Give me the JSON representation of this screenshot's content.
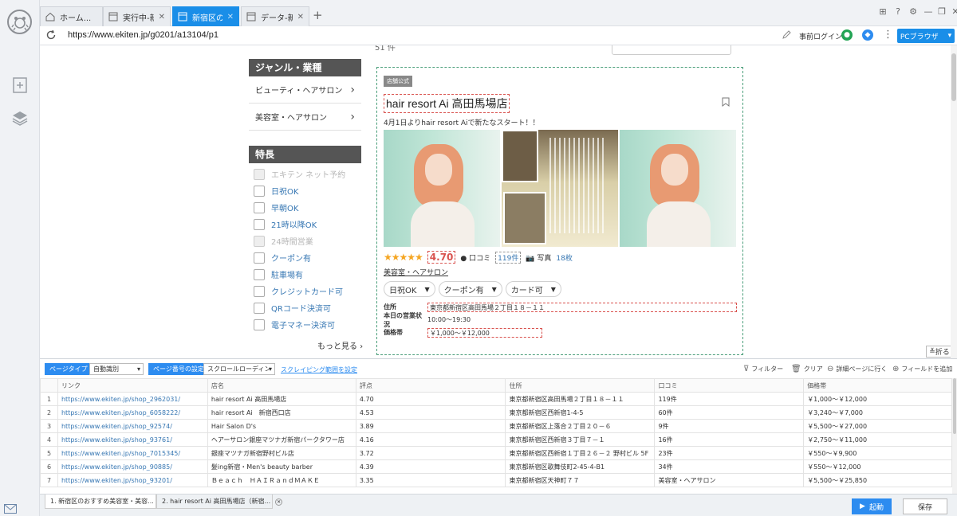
{
  "tabs": [
    {
      "label": "ホーム...",
      "active": false
    },
    {
      "label": "実行中-新...",
      "active": false
    },
    {
      "label": "新宿区の...",
      "active": true
    },
    {
      "label": "データ-新...",
      "active": false
    }
  ],
  "address": {
    "url": "https://www.ekiten.jp/g0201/a13104/p1",
    "prelogin": "事前ログイン",
    "pc_browser": "PCブラウザ"
  },
  "page": {
    "top_fragment": "51 件",
    "genre_header": "ジャンル・業種",
    "genre_items": [
      "ビューティ・ヘアサロン",
      "美容室・ヘアサロン"
    ],
    "feature_header": "特長",
    "features": [
      {
        "label": "エキテン ネット予約",
        "disabled": true
      },
      {
        "label": "日祝OK",
        "disabled": false
      },
      {
        "label": "早朝OK",
        "disabled": false
      },
      {
        "label": "21時以降OK",
        "disabled": false
      },
      {
        "label": "24時間営業",
        "disabled": true
      },
      {
        "label": "クーポン有",
        "disabled": false
      },
      {
        "label": "駐車場有",
        "disabled": false
      },
      {
        "label": "クレジットカード可",
        "disabled": false
      },
      {
        "label": "QRコード決済可",
        "disabled": false
      },
      {
        "label": "電子マネー決済可",
        "disabled": false
      }
    ],
    "more_link": "もっと見る",
    "card": {
      "badge": "店舗公式",
      "title": "hair resort Ai 高田馬場店",
      "desc": "4月1日よりhair resort Aiで新たなスタート！！",
      "score": "4.70",
      "reviews_label": "口コミ",
      "reviews_count": "119件",
      "photos_label": "写真",
      "photos_count": "18枚",
      "genre": "美容室・ヘアサロン",
      "pills": [
        "日祝OK",
        "クーポン有",
        "カード可"
      ],
      "address_label": "住所",
      "address": "東京都新宿区高田馬場２丁目１８－１１",
      "hours_label": "本日の営業状況",
      "hours": "10:00～19:30",
      "price_label": "価格帯",
      "price": "￥1,000～￥12,000"
    },
    "fold_label": "折る"
  },
  "panel": {
    "page_type_label": "ページタイプ",
    "page_type_value": "自動識別",
    "page_num_label": "ページ番号の設定",
    "page_num_value": "スクロールローディン",
    "scrape_range": "スクレイピング範囲を設定",
    "actions": {
      "filter": "フィルター",
      "clear": "クリア",
      "detail": "詳細ページに行く",
      "add_field": "フィールドを追加"
    },
    "columns": [
      "リンク",
      "店名",
      "評点",
      "住所",
      "口コミ",
      "価格帯"
    ],
    "rows": [
      [
        "1",
        "https://www.ekiten.jp/shop_2962031/",
        "hair resort Ai 高田馬場店",
        "4.70",
        "東京都新宿区高田馬場２丁目１８－１１",
        "119件",
        "￥1,000～￥12,000"
      ],
      [
        "2",
        "https://www.ekiten.jp/shop_6058222/",
        "hair resort Ai　新宿西口店",
        "4.53",
        "東京都新宿区西新宿1-4-5",
        "60件",
        "￥3,240～￥7,000"
      ],
      [
        "3",
        "https://www.ekiten.jp/shop_92574/",
        "Hair Salon D's",
        "3.89",
        "東京都新宿区上落合２丁目２０－６",
        "9件",
        "￥5,500～￥27,000"
      ],
      [
        "4",
        "https://www.ekiten.jp/shop_93761/",
        "ヘアーサロン銀座マツナガ新宿パークタワー店",
        "4.16",
        "東京都新宿区西新宿３丁目７－１",
        "16件",
        "￥2,750～￥11,000"
      ],
      [
        "5",
        "https://www.ekiten.jp/shop_7015345/",
        "銀座マツナガ新宿野村ビル店",
        "3.72",
        "東京都新宿区西新宿１丁目２６－２ 野村ビル 5F",
        "23件",
        "￥550～￥9,900"
      ],
      [
        "6",
        "https://www.ekiten.jp/shop_90885/",
        "髪ing新宿・Men's beauty barber",
        "4.39",
        "東京都新宿区歌舞伎町2-45-4-B1",
        "34件",
        "￥550～￥12,000"
      ],
      [
        "7",
        "https://www.ekiten.jp/shop_93201/",
        "Ｂｅａｃｈ　ＨＡＩＲａｎｄＭＡＫＥ",
        "3.35",
        "東京都新宿区天神町７７",
        "美容室・ヘアサロン",
        "￥5,500～￥25,850"
      ]
    ]
  },
  "bottom": {
    "tab1": "1. 新宿区のおすすめ美容室・美容...",
    "tab2": "2. hair resort Ai 高田馬場店（新宿...",
    "run": "起動",
    "save": "保存"
  }
}
